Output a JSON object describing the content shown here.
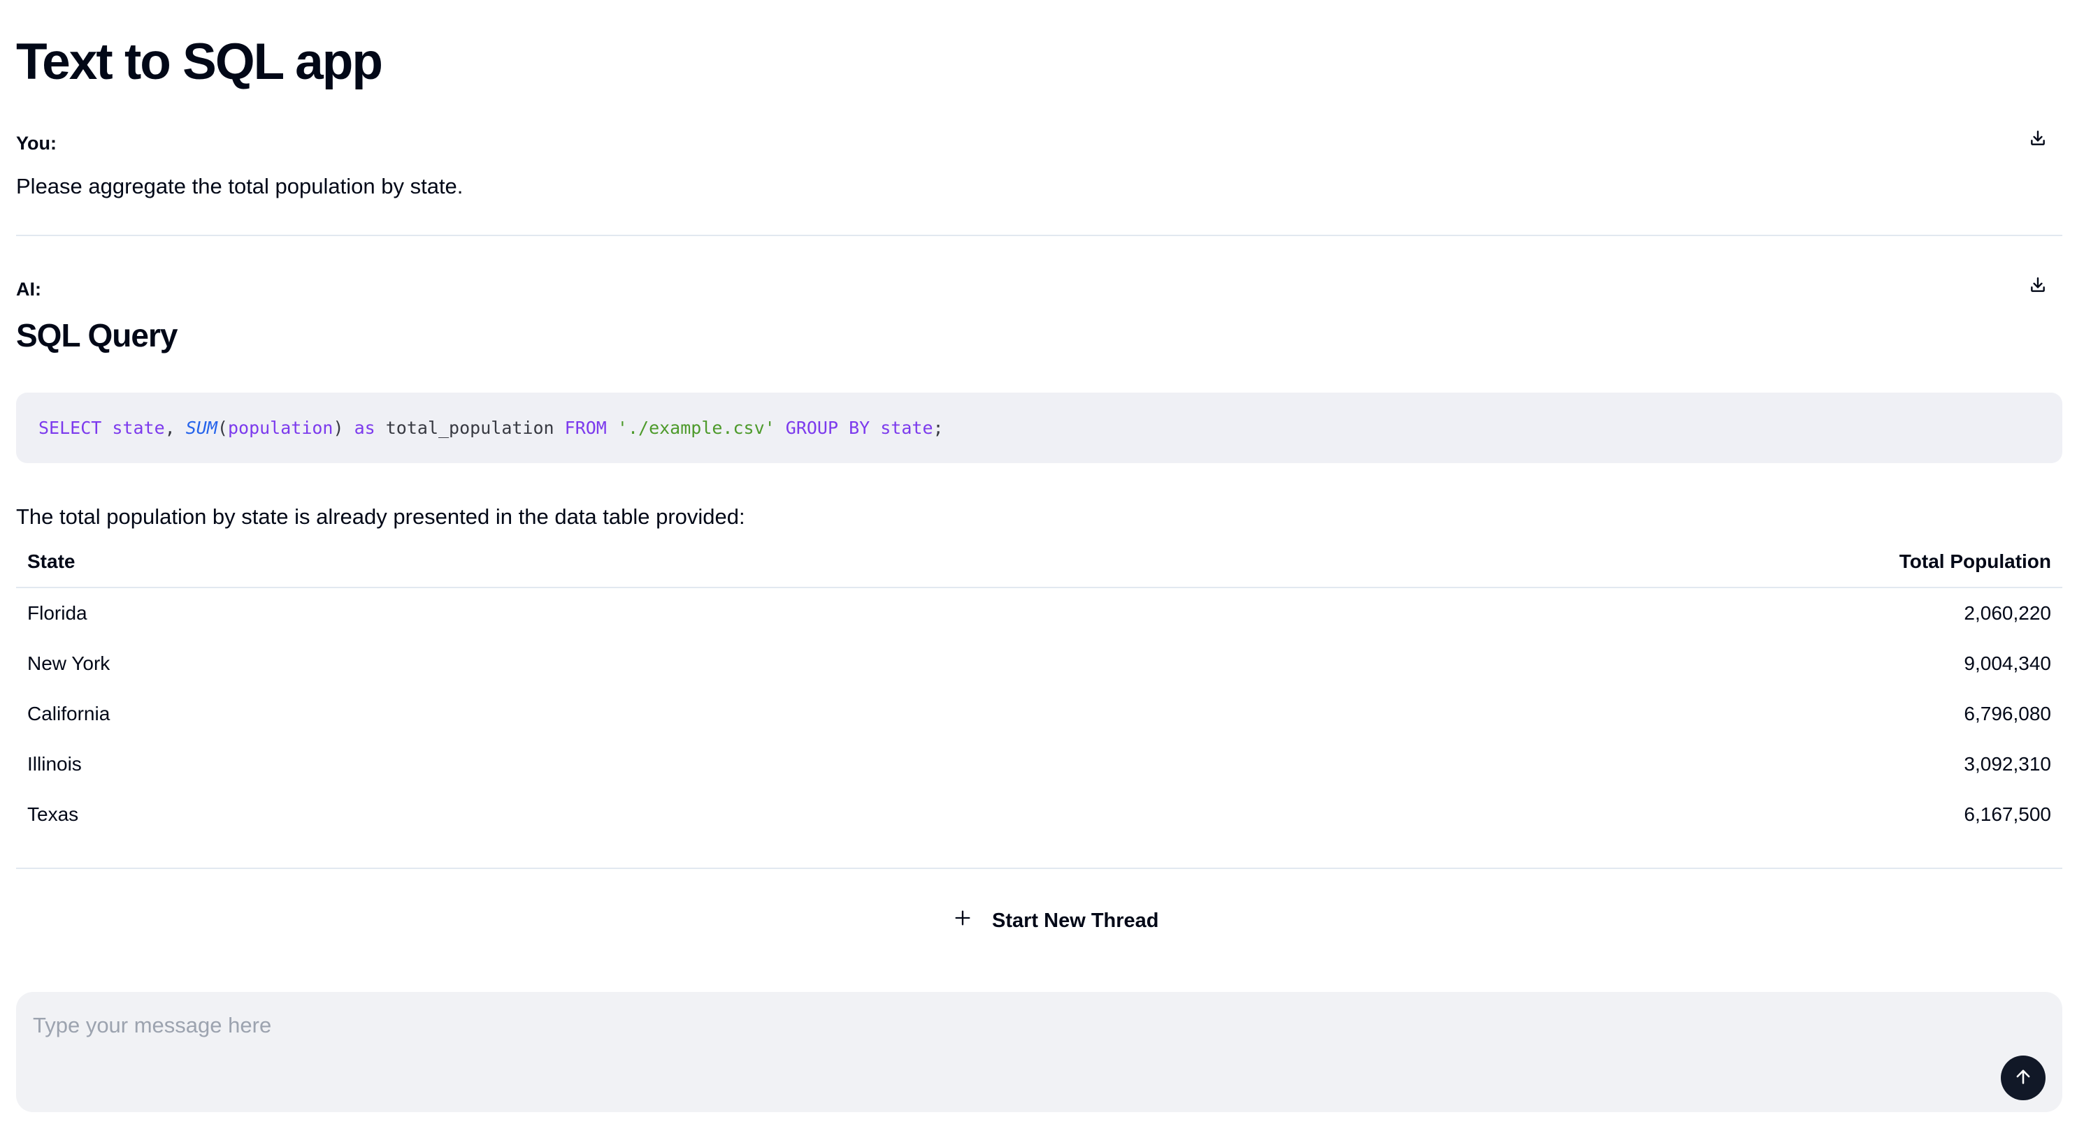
{
  "app": {
    "title": "Text to SQL app"
  },
  "icons": {
    "download": "download-icon",
    "plus": "plus-icon",
    "send": "arrow-up-icon"
  },
  "messages": {
    "user": {
      "label": "You:",
      "text": "Please aggregate the total population by state."
    },
    "ai": {
      "label": "AI:",
      "heading": "SQL Query",
      "code": {
        "language": "sql",
        "tokens": [
          {
            "t": "SELECT",
            "k": "kw"
          },
          {
            "t": " ",
            "k": "pl"
          },
          {
            "t": "state",
            "k": "id"
          },
          {
            "t": ", ",
            "k": "pl"
          },
          {
            "t": "SUM",
            "k": "fn"
          },
          {
            "t": "(",
            "k": "pl"
          },
          {
            "t": "population",
            "k": "id"
          },
          {
            "t": ") ",
            "k": "pl"
          },
          {
            "t": "as",
            "k": "kw"
          },
          {
            "t": " total_population ",
            "k": "pl"
          },
          {
            "t": "FROM",
            "k": "kw"
          },
          {
            "t": " ",
            "k": "pl"
          },
          {
            "t": "'./example.csv'",
            "k": "str"
          },
          {
            "t": " ",
            "k": "pl"
          },
          {
            "t": "GROUP BY",
            "k": "kw"
          },
          {
            "t": " ",
            "k": "pl"
          },
          {
            "t": "state",
            "k": "id"
          },
          {
            "t": ";",
            "k": "pl"
          }
        ]
      },
      "text": "The total population by state is already presented in the data table provided:",
      "table": {
        "columns": [
          "State",
          "Total Population"
        ],
        "rows": [
          [
            "Florida",
            "2,060,220"
          ],
          [
            "New York",
            "9,004,340"
          ],
          [
            "California",
            "6,796,080"
          ],
          [
            "Illinois",
            "3,092,310"
          ],
          [
            "Texas",
            "6,167,500"
          ]
        ]
      }
    }
  },
  "actions": {
    "new_thread_label": "Start New Thread"
  },
  "composer": {
    "placeholder": "Type your message here",
    "value": ""
  },
  "colors": {
    "text": "#020817",
    "divider": "#e2e8f0",
    "code_bg": "#eff0f5",
    "keyword": "#7c3aed",
    "function": "#2563eb",
    "string": "#4d9a2b",
    "composer_bg": "#f1f2f5",
    "send_button": "#111827"
  }
}
